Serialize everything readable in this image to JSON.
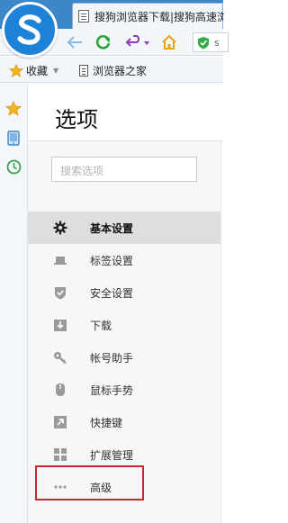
{
  "browser": {
    "tab_title": "搜狗浏览器下载|搜狗高速浏览器",
    "url_partial": "s",
    "bookmarks_bar": {
      "favorites_label": "收藏",
      "items": [
        "浏览器之家"
      ]
    }
  },
  "colors": {
    "brand_blue": "#1e82d8",
    "refresh_green": "#2aa33a",
    "undo_purple": "#8a3fb8",
    "home_orange": "#e8a315",
    "highlight_red": "#c8282f"
  },
  "sidebar_icons": [
    "star-icon",
    "tablet-icon",
    "clock-icon"
  ],
  "options": {
    "title": "选项",
    "search_placeholder": "搜索选项",
    "menu": [
      {
        "label": "基本设置",
        "icon": "gear-icon",
        "active": true
      },
      {
        "label": "标签设置",
        "icon": "laptop-icon",
        "active": false
      },
      {
        "label": "安全设置",
        "icon": "shield-check-icon",
        "active": false
      },
      {
        "label": "下载",
        "icon": "download-icon",
        "active": false
      },
      {
        "label": "帐号助手",
        "icon": "key-icon",
        "active": false
      },
      {
        "label": "鼠标手势",
        "icon": "mouse-icon",
        "active": false
      },
      {
        "label": "快捷键",
        "icon": "shortcut-arrow-icon",
        "active": false
      },
      {
        "label": "扩展管理",
        "icon": "extension-grid-icon",
        "active": false
      },
      {
        "label": "高级",
        "icon": "more-dots-icon",
        "active": false
      }
    ]
  }
}
